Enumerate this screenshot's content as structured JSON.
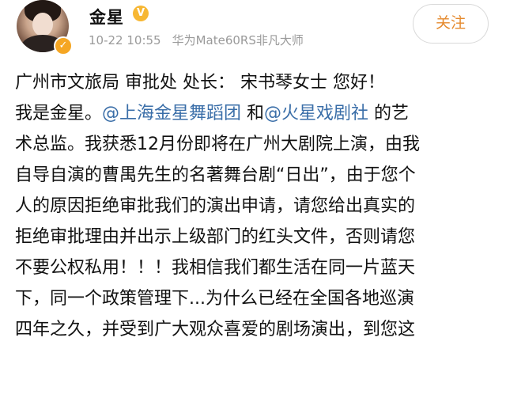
{
  "post": {
    "author": {
      "name": "金星",
      "vip_badge": "V",
      "verified_badge": "✓"
    },
    "meta": {
      "time": "10-22 10:55",
      "device": "华为Mate60RS非凡大师"
    },
    "follow_label": "关注",
    "greeting": "广州市文旅局 审批处 处长： 宋书琴女士 您好！",
    "body": {
      "intro_prefix": "我是金星。",
      "mention1": "@上海金星舞蹈团",
      "join": " 和",
      "mention2": "@火星戏剧社",
      "suffix1": " 的艺",
      "line3": "术总监。我获悉12月份即将在广州大剧院上演，由我",
      "line4": "自导自演的曹禺先生的名著舞台剧“日出”，由于您个",
      "line5": "人的原因拒绝审批我们的演出申请，请您给出真实的",
      "line6": "拒绝审批理由并出示上级部门的红头文件，否则请您",
      "line7": "不要公权私用！！！我相信我们都生活在同一片蓝天",
      "line8": "下，同一个政策管理下...为什么已经在全国各地巡演",
      "line9": "四年之久，并受到广大观众喜爱的剧场演出，到您这"
    }
  },
  "colors": {
    "mention": "#3a6ea8",
    "follow_text": "#e58a2e",
    "meta_text": "#9a9a9a"
  }
}
